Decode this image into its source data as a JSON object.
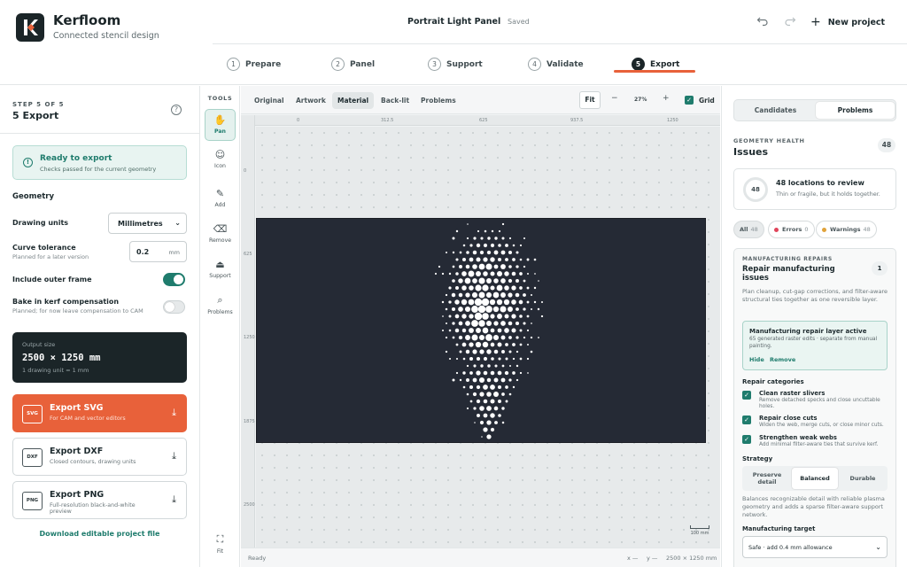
{
  "app": {
    "name": "Kerfloom",
    "tagline": "Connected stencil design",
    "logo_letter": "K"
  },
  "project": {
    "title": "Portrait Light Panel",
    "status": "Saved",
    "new_project_label": "New project"
  },
  "steps": [
    {
      "num": "1",
      "label": "Prepare"
    },
    {
      "num": "2",
      "label": "Panel"
    },
    {
      "num": "3",
      "label": "Support"
    },
    {
      "num": "4",
      "label": "Validate"
    },
    {
      "num": "5",
      "label": "Export",
      "active": true
    }
  ],
  "left": {
    "step_of": "STEP 5 OF 5",
    "title": "5 Export",
    "ready": {
      "title": "Ready to export",
      "subtitle": "Checks passed for the current geometry"
    },
    "geometry_label": "Geometry",
    "drawing_units": {
      "label": "Drawing units",
      "value": "Millimetres"
    },
    "curve_tolerance": {
      "label": "Curve tolerance",
      "sub": "Planned for a later version",
      "value": "0.2",
      "unit": "mm"
    },
    "outer_frame": {
      "label": "Include outer frame",
      "on": true
    },
    "bake_kerf": {
      "label": "Bake in kerf compensation",
      "sub": "Planned; for now leave compensation to CAM",
      "on": false
    },
    "output": {
      "label": "Output size",
      "size": "2500 × 1250 mm",
      "note": "1 drawing unit = 1 mm"
    },
    "exports": [
      {
        "badge": "SVG",
        "title": "Export SVG",
        "sub": "For CAM and vector editors"
      },
      {
        "badge": "DXF",
        "title": "Export DXF",
        "sub": "Closed contours, drawing units"
      },
      {
        "badge": "PNG",
        "title": "Export PNG",
        "sub": "Full-resolution black-and-white preview"
      }
    ],
    "download_link": "Download editable project file"
  },
  "tools": {
    "label": "TOOLS",
    "items": [
      {
        "label": "Pan",
        "icon": "hand-icon",
        "active": true
      },
      {
        "label": "Icon",
        "icon": "person-icon"
      },
      {
        "label": "Add",
        "icon": "pen-plus-icon"
      },
      {
        "label": "Remove",
        "icon": "eraser-icon"
      },
      {
        "label": "Support",
        "icon": "support-icon"
      },
      {
        "label": "Problems",
        "icon": "magnifier-icon"
      },
      {
        "label": "Fit",
        "icon": "fit-icon"
      }
    ]
  },
  "canvas": {
    "tabs": [
      "Original",
      "Artwork",
      "Material",
      "Back-lit",
      "Problems"
    ],
    "active_tab": "Material",
    "fit_label": "Fit",
    "zoom": "27%",
    "grid_label": "Grid",
    "grid_on": true,
    "ruler_top": [
      "0",
      "312.5",
      "625",
      "937.5",
      "1250"
    ],
    "ruler_left": [
      "0",
      "625",
      "1250",
      "1875",
      "2500"
    ],
    "scale_label": "100 mm",
    "status": "Ready",
    "cursor_x": "x —",
    "cursor_y": "y —",
    "doc_size": "2500 × 1250 mm",
    "colors": {
      "stencil": "#252a35",
      "cut": "#ffffff",
      "workspace": "#e7eaeb"
    }
  },
  "right": {
    "tabs": [
      "Candidates",
      "Problems"
    ],
    "active_tab": "Problems",
    "health_label": "GEOMETRY HEALTH",
    "health_title": "Issues",
    "health_count": "48",
    "review": {
      "count": "48",
      "title": "48 locations to review",
      "sub": "Thin or fragile, but it holds together."
    },
    "filters": [
      {
        "label": "All",
        "count": "48"
      },
      {
        "label": "Errors",
        "count": "0",
        "color": "#e0445a"
      },
      {
        "label": "Warnings",
        "count": "48",
        "color": "#e0a23a"
      }
    ],
    "repairs": {
      "label": "MANUFACTURING REPAIRS",
      "title": "Repair manufacturing issues",
      "count": "1",
      "desc": "Plan cleanup, cut-gap corrections, and filter-aware structural ties together as one reversible layer.",
      "layer": {
        "title": "Manufacturing repair layer active",
        "sub": "65 generated raster edits · separate from manual painting.",
        "hide": "Hide",
        "remove": "Remove"
      },
      "categories_label": "Repair categories",
      "categories": [
        {
          "title": "Clean raster slivers",
          "sub": "Remove detached specks and close uncuttable holes."
        },
        {
          "title": "Repair close cuts",
          "sub": "Widen the web, merge cuts, or close minor cuts."
        },
        {
          "title": "Strengthen weak webs",
          "sub": "Add minimal filter-aware ties that survive kerf."
        }
      ],
      "strategy_label": "Strategy",
      "strategies": [
        "Preserve detail",
        "Balanced",
        "Durable"
      ],
      "active_strategy": "Balanced",
      "strategy_desc": "Balances recognizable detail with reliable plasma geometry and adds a sparse filter-aware support network.",
      "target_label": "Manufacturing target",
      "target_value": "Safe · add 0.4 mm allowance"
    }
  }
}
